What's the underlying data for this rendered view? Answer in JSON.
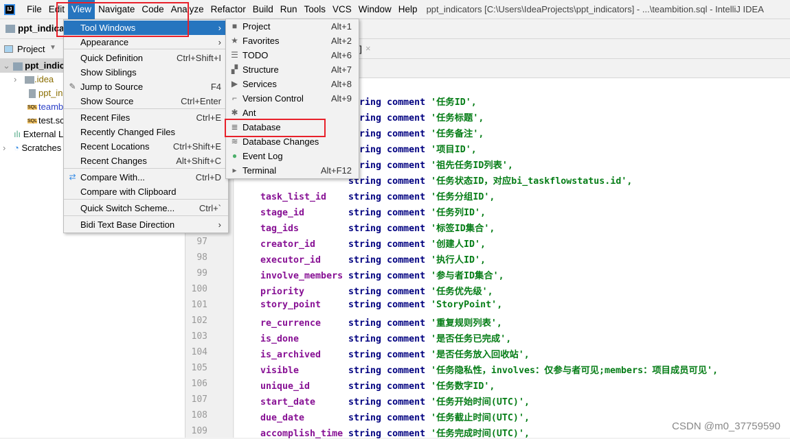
{
  "menubar": {
    "items": [
      "File",
      "Edit",
      "View",
      "Navigate",
      "Code",
      "Analyze",
      "Refactor",
      "Build",
      "Run",
      "Tools",
      "VCS",
      "Window",
      "Help"
    ],
    "title": "ppt_indicators [C:\\Users\\IdeaProjects\\ppt_indicators] - ...\\teambition.sql - IntelliJ IDEA"
  },
  "navbar": {
    "project": "ppt_indicat"
  },
  "project_panel": {
    "label": "Project",
    "tree": [
      "ppt_indic",
      ".idea",
      "ppt_in",
      "teamb",
      "test.sc",
      "External L",
      "Scratches"
    ]
  },
  "tab": {
    "label": "e]"
  },
  "view_menu": [
    {
      "label": "Tool Windows",
      "shortcut": "",
      "submenu": true
    },
    {
      "label": "Appearance",
      "shortcut": "",
      "submenu": true
    },
    {
      "label": "Quick Definition",
      "shortcut": "Ctrl+Shift+I"
    },
    {
      "label": "Show Siblings",
      "shortcut": ""
    },
    {
      "label": "Jump to Source",
      "shortcut": "F4"
    },
    {
      "label": "Show Source",
      "shortcut": "Ctrl+Enter"
    },
    {
      "label": "Recent Files",
      "shortcut": "Ctrl+E"
    },
    {
      "label": "Recently Changed Files",
      "shortcut": ""
    },
    {
      "label": "Recent Locations",
      "shortcut": "Ctrl+Shift+E"
    },
    {
      "label": "Recent Changes",
      "shortcut": "Alt+Shift+C"
    },
    {
      "label": "Compare With...",
      "shortcut": "Ctrl+D"
    },
    {
      "label": "Compare with Clipboard",
      "shortcut": ""
    },
    {
      "label": "Quick Switch Scheme...",
      "shortcut": "Ctrl+`"
    },
    {
      "label": "Bidi Text Base Direction",
      "shortcut": "",
      "submenu": true
    }
  ],
  "tool_windows_menu": [
    {
      "label": "Project",
      "shortcut": "Alt+1",
      "icon": "folder-icon"
    },
    {
      "label": "Favorites",
      "shortcut": "Alt+2",
      "icon": "star-icon"
    },
    {
      "label": "TODO",
      "shortcut": "Alt+6",
      "icon": "list-icon"
    },
    {
      "label": "Structure",
      "shortcut": "Alt+7",
      "icon": "structure-icon"
    },
    {
      "label": "Services",
      "shortcut": "Alt+8",
      "icon": "services-icon"
    },
    {
      "label": "Version Control",
      "shortcut": "Alt+9",
      "icon": "vcs-icon"
    },
    {
      "label": "Ant",
      "shortcut": "",
      "icon": "ant-icon"
    },
    {
      "label": "Database",
      "shortcut": "",
      "icon": "database-icon"
    },
    {
      "label": "Database Changes",
      "shortcut": "",
      "icon": "database-changes-icon"
    },
    {
      "label": "Event Log",
      "shortcut": "",
      "icon": "event-log-icon"
    },
    {
      "label": "Terminal",
      "shortcut": "Alt+F12",
      "icon": "terminal-icon"
    }
  ],
  "code": [
    {
      "n": "",
      "f": "",
      "c": "'任务ID',"
    },
    {
      "n": "",
      "f": "",
      "c": "'任务标题',"
    },
    {
      "n": "",
      "f": "",
      "c": "'任务备注',"
    },
    {
      "n": "",
      "f": "",
      "c": "'项目ID',"
    },
    {
      "n": "",
      "f": "",
      "c": "'祖先任务ID列表',"
    },
    {
      "n": "",
      "f": "",
      "c": "'任务状态ID，对应bi_taskflowstatus.id',"
    },
    {
      "n": "",
      "f": "task_list_id",
      "c": "'任务分组ID',"
    },
    {
      "n": "",
      "f": "stage_id",
      "c": "'任务列ID',"
    },
    {
      "n": "",
      "f": "tag_ids",
      "c": "'标签ID集合',"
    },
    {
      "n": "97",
      "f": "creator_id",
      "c": "'创建人ID',"
    },
    {
      "n": "98",
      "f": "executor_id",
      "c": "'执行人ID',"
    },
    {
      "n": "99",
      "f": "involve_members",
      "c": "'参与者ID集合',"
    },
    {
      "n": "100",
      "f": "priority",
      "c": "'任务优先级',"
    },
    {
      "n": "101",
      "f": "story_point",
      "c": "'StoryPoint',"
    },
    {
      "n": "102",
      "f": "re_currence",
      "c": "'重复规则列表',"
    },
    {
      "n": "103",
      "f": "is_done",
      "c": "'是否任务已完成',"
    },
    {
      "n": "104",
      "f": "is_archived",
      "c": "'是否任务放入回收站',"
    },
    {
      "n": "105",
      "f": "visible",
      "c": "'任务隐私性，involves：仅参与者可见;members：项目成员可见',"
    },
    {
      "n": "106",
      "f": "unique_id",
      "c": "'任务数字ID',"
    },
    {
      "n": "107",
      "f": "start_date",
      "c": "'任务开始时间(UTC)',"
    },
    {
      "n": "108",
      "f": "due_date",
      "c": "'任务截止时间(UTC)',"
    },
    {
      "n": "109",
      "f": "accomplish_time",
      "c": "'任务完成时间(UTC)',"
    }
  ],
  "keywords": {
    "type": "string",
    "comment": "comment"
  },
  "watermark": "CSDN @m0_37759590"
}
